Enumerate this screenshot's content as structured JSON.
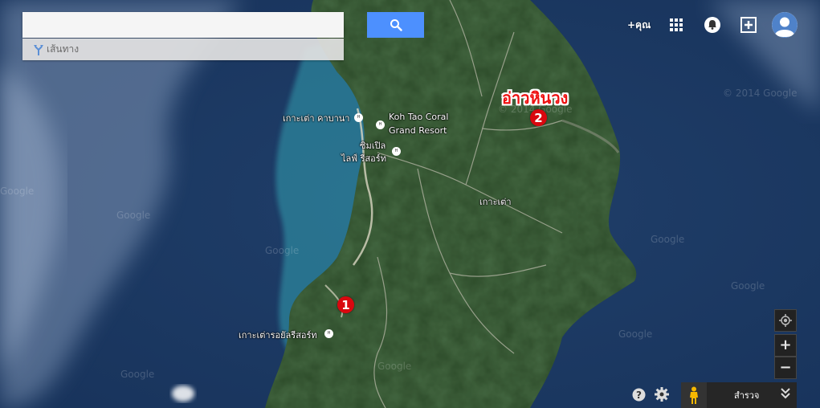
{
  "search": {
    "placeholder": "",
    "value": ""
  },
  "directions": {
    "label": "เส้นทาง"
  },
  "header": {
    "plus_you": "+คุณ"
  },
  "icons": {
    "search": "search-icon",
    "directions": "directions-icon",
    "apps": "apps-grid-icon",
    "notifications": "bell-icon",
    "share": "add-share-icon",
    "avatar": "avatar-icon",
    "my_location": "my-location-icon",
    "zoom_in": "zoom-in-icon",
    "zoom_out": "zoom-out-icon",
    "help": "help-icon",
    "settings": "gear-icon",
    "pegman": "pegman-icon",
    "expand": "double-chevron-down-icon"
  },
  "map": {
    "highlight_label": "อ่าวหินวง",
    "labels": {
      "kata_bay": "เกาะเต่า คาบานา",
      "coral_1": "Koh Tao Coral",
      "coral_2": "Grand Resort",
      "simple_1": "ซิมเปิล",
      "simple_2": "ไลฟ์ รีสอร์ท",
      "kohtao": "เกาะเต่า",
      "royal": "เกาะเต่ารอยัลรีสอร์ท"
    },
    "markers": [
      "1",
      "2"
    ],
    "watermarks": [
      "© 2014 Google",
      "© 2014 Google",
      "Google",
      "Google",
      "Google",
      "Google",
      "Google",
      "Google",
      "Google",
      "Google"
    ]
  },
  "controls": {
    "zoom_in": "+",
    "zoom_out": "−"
  },
  "bottom": {
    "explore_label": "สำรวจ"
  },
  "colors": {
    "search_button": "#4d90fe",
    "marker": "#d9080f",
    "highlight_label": "#ee1111",
    "ocean": "#1f3e66",
    "land": "#2d4a26"
  }
}
